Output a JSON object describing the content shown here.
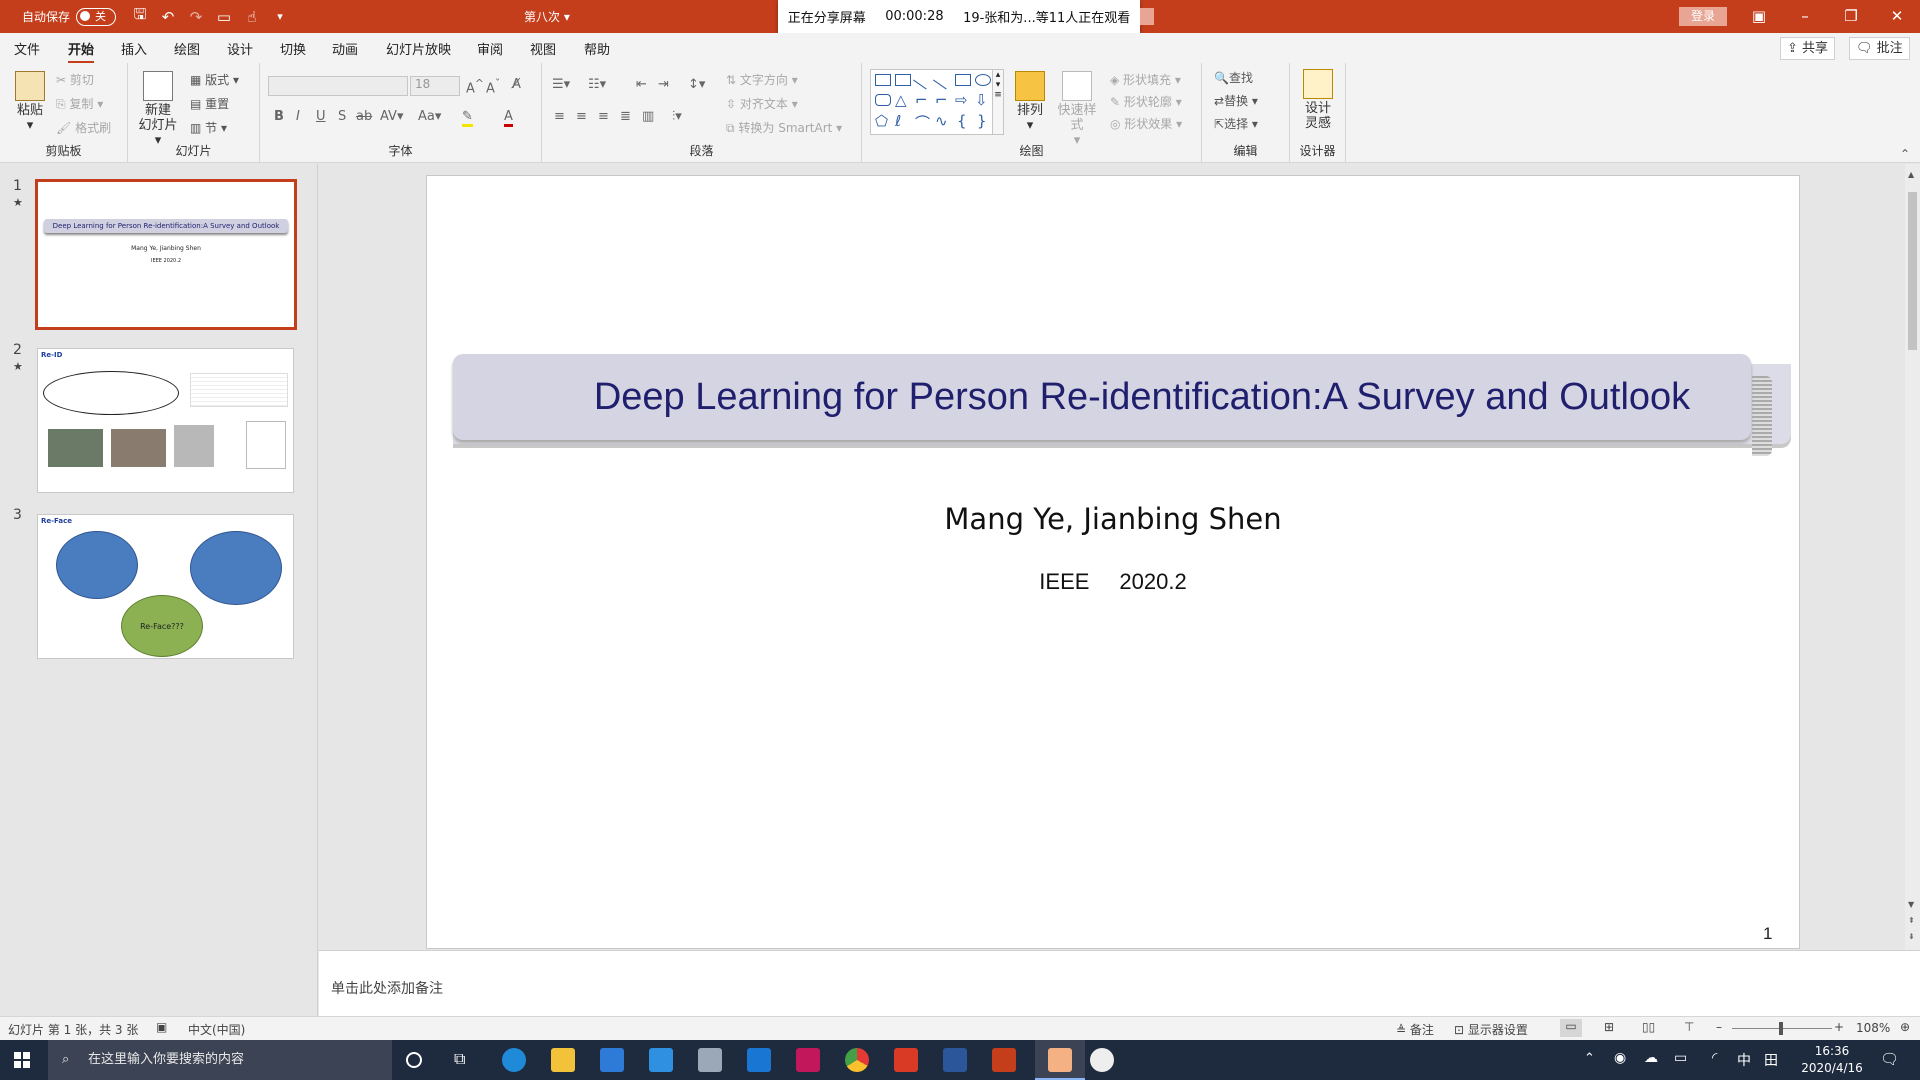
{
  "titlebar": {
    "autosave_label": "自动保存",
    "autosave_state": "关",
    "doc_title": "第八次",
    "share": {
      "status": "正在分享屏幕",
      "timer": "00:00:28",
      "viewers": "19-张和为...等11人正在观看"
    },
    "login": "登录"
  },
  "tabs": [
    "文件",
    "开始",
    "插入",
    "绘图",
    "设计",
    "切换",
    "动画",
    "幻灯片放映",
    "审阅",
    "视图",
    "帮助"
  ],
  "active_tab": "开始",
  "top_actions": {
    "share": "共享",
    "comments": "批注"
  },
  "ribbon": {
    "clipboard": {
      "paste": "粘贴",
      "cut": "剪切",
      "copy": "复制",
      "format_painter": "格式刷",
      "label": "剪贴板"
    },
    "slides": {
      "new_slide": "新建",
      "new_slide2": "幻灯片",
      "layout": "版式",
      "reset": "重置",
      "section": "节",
      "label": "幻灯片"
    },
    "font": {
      "size": "18",
      "label": "字体"
    },
    "paragraph": {
      "text_direction": "文字方向",
      "align_text": "对齐文本",
      "smartart": "转换为 SmartArt",
      "label": "段落"
    },
    "drawing": {
      "arrange": "排列",
      "quick_styles": "快速样式",
      "fill": "形状填充",
      "outline": "形状轮廓",
      "effects": "形状效果",
      "label": "绘图"
    },
    "editing": {
      "find": "查找",
      "replace": "替换",
      "select": "选择",
      "label": "编辑"
    },
    "designer": {
      "ideas1": "设计",
      "ideas2": "灵感",
      "label": "设计器"
    }
  },
  "thumbnails": [
    {
      "num": "1",
      "title": "Deep Learning for Person Re-identification:A Survey and Outlook",
      "authors": "Mang Ye, Jianbing Shen",
      "venue": "IEEE   2020.2"
    },
    {
      "num": "2",
      "title": "Re-ID"
    },
    {
      "num": "3",
      "title": "Re-Face",
      "center_label": "Re-Face???"
    }
  ],
  "slide": {
    "title": "Deep Learning for Person Re-identification:A Survey and Outlook",
    "authors": "Mang Ye, Jianbing Shen",
    "venue": "IEEE",
    "date": "2020.2",
    "page_number": "1"
  },
  "notes_placeholder": "单击此处添加备注",
  "status": {
    "slide_info": "幻灯片 第 1 张，共 3 张",
    "language": "中文(中国)",
    "notes": "备注",
    "display_settings": "显示器设置",
    "zoom": "108%"
  },
  "taskbar": {
    "search_placeholder": "在这里输入你要搜索的内容",
    "ime1": "中",
    "ime2": "田",
    "time": "16:36",
    "date": "2020/4/16"
  }
}
